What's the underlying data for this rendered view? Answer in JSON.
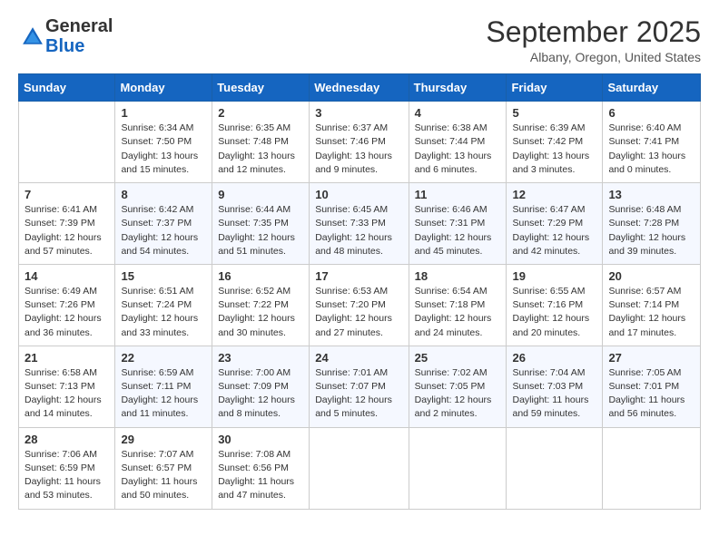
{
  "header": {
    "logo_general": "General",
    "logo_blue": "Blue",
    "month_title": "September 2025",
    "subtitle": "Albany, Oregon, United States"
  },
  "weekdays": [
    "Sunday",
    "Monday",
    "Tuesday",
    "Wednesday",
    "Thursday",
    "Friday",
    "Saturday"
  ],
  "weeks": [
    [
      {
        "day": "",
        "sunrise": "",
        "sunset": "",
        "daylight": ""
      },
      {
        "day": "1",
        "sunrise": "Sunrise: 6:34 AM",
        "sunset": "Sunset: 7:50 PM",
        "daylight": "Daylight: 13 hours and 15 minutes."
      },
      {
        "day": "2",
        "sunrise": "Sunrise: 6:35 AM",
        "sunset": "Sunset: 7:48 PM",
        "daylight": "Daylight: 13 hours and 12 minutes."
      },
      {
        "day": "3",
        "sunrise": "Sunrise: 6:37 AM",
        "sunset": "Sunset: 7:46 PM",
        "daylight": "Daylight: 13 hours and 9 minutes."
      },
      {
        "day": "4",
        "sunrise": "Sunrise: 6:38 AM",
        "sunset": "Sunset: 7:44 PM",
        "daylight": "Daylight: 13 hours and 6 minutes."
      },
      {
        "day": "5",
        "sunrise": "Sunrise: 6:39 AM",
        "sunset": "Sunset: 7:42 PM",
        "daylight": "Daylight: 13 hours and 3 minutes."
      },
      {
        "day": "6",
        "sunrise": "Sunrise: 6:40 AM",
        "sunset": "Sunset: 7:41 PM",
        "daylight": "Daylight: 13 hours and 0 minutes."
      }
    ],
    [
      {
        "day": "7",
        "sunrise": "Sunrise: 6:41 AM",
        "sunset": "Sunset: 7:39 PM",
        "daylight": "Daylight: 12 hours and 57 minutes."
      },
      {
        "day": "8",
        "sunrise": "Sunrise: 6:42 AM",
        "sunset": "Sunset: 7:37 PM",
        "daylight": "Daylight: 12 hours and 54 minutes."
      },
      {
        "day": "9",
        "sunrise": "Sunrise: 6:44 AM",
        "sunset": "Sunset: 7:35 PM",
        "daylight": "Daylight: 12 hours and 51 minutes."
      },
      {
        "day": "10",
        "sunrise": "Sunrise: 6:45 AM",
        "sunset": "Sunset: 7:33 PM",
        "daylight": "Daylight: 12 hours and 48 minutes."
      },
      {
        "day": "11",
        "sunrise": "Sunrise: 6:46 AM",
        "sunset": "Sunset: 7:31 PM",
        "daylight": "Daylight: 12 hours and 45 minutes."
      },
      {
        "day": "12",
        "sunrise": "Sunrise: 6:47 AM",
        "sunset": "Sunset: 7:29 PM",
        "daylight": "Daylight: 12 hours and 42 minutes."
      },
      {
        "day": "13",
        "sunrise": "Sunrise: 6:48 AM",
        "sunset": "Sunset: 7:28 PM",
        "daylight": "Daylight: 12 hours and 39 minutes."
      }
    ],
    [
      {
        "day": "14",
        "sunrise": "Sunrise: 6:49 AM",
        "sunset": "Sunset: 7:26 PM",
        "daylight": "Daylight: 12 hours and 36 minutes."
      },
      {
        "day": "15",
        "sunrise": "Sunrise: 6:51 AM",
        "sunset": "Sunset: 7:24 PM",
        "daylight": "Daylight: 12 hours and 33 minutes."
      },
      {
        "day": "16",
        "sunrise": "Sunrise: 6:52 AM",
        "sunset": "Sunset: 7:22 PM",
        "daylight": "Daylight: 12 hours and 30 minutes."
      },
      {
        "day": "17",
        "sunrise": "Sunrise: 6:53 AM",
        "sunset": "Sunset: 7:20 PM",
        "daylight": "Daylight: 12 hours and 27 minutes."
      },
      {
        "day": "18",
        "sunrise": "Sunrise: 6:54 AM",
        "sunset": "Sunset: 7:18 PM",
        "daylight": "Daylight: 12 hours and 24 minutes."
      },
      {
        "day": "19",
        "sunrise": "Sunrise: 6:55 AM",
        "sunset": "Sunset: 7:16 PM",
        "daylight": "Daylight: 12 hours and 20 minutes."
      },
      {
        "day": "20",
        "sunrise": "Sunrise: 6:57 AM",
        "sunset": "Sunset: 7:14 PM",
        "daylight": "Daylight: 12 hours and 17 minutes."
      }
    ],
    [
      {
        "day": "21",
        "sunrise": "Sunrise: 6:58 AM",
        "sunset": "Sunset: 7:13 PM",
        "daylight": "Daylight: 12 hours and 14 minutes."
      },
      {
        "day": "22",
        "sunrise": "Sunrise: 6:59 AM",
        "sunset": "Sunset: 7:11 PM",
        "daylight": "Daylight: 12 hours and 11 minutes."
      },
      {
        "day": "23",
        "sunrise": "Sunrise: 7:00 AM",
        "sunset": "Sunset: 7:09 PM",
        "daylight": "Daylight: 12 hours and 8 minutes."
      },
      {
        "day": "24",
        "sunrise": "Sunrise: 7:01 AM",
        "sunset": "Sunset: 7:07 PM",
        "daylight": "Daylight: 12 hours and 5 minutes."
      },
      {
        "day": "25",
        "sunrise": "Sunrise: 7:02 AM",
        "sunset": "Sunset: 7:05 PM",
        "daylight": "Daylight: 12 hours and 2 minutes."
      },
      {
        "day": "26",
        "sunrise": "Sunrise: 7:04 AM",
        "sunset": "Sunset: 7:03 PM",
        "daylight": "Daylight: 11 hours and 59 minutes."
      },
      {
        "day": "27",
        "sunrise": "Sunrise: 7:05 AM",
        "sunset": "Sunset: 7:01 PM",
        "daylight": "Daylight: 11 hours and 56 minutes."
      }
    ],
    [
      {
        "day": "28",
        "sunrise": "Sunrise: 7:06 AM",
        "sunset": "Sunset: 6:59 PM",
        "daylight": "Daylight: 11 hours and 53 minutes."
      },
      {
        "day": "29",
        "sunrise": "Sunrise: 7:07 AM",
        "sunset": "Sunset: 6:57 PM",
        "daylight": "Daylight: 11 hours and 50 minutes."
      },
      {
        "day": "30",
        "sunrise": "Sunrise: 7:08 AM",
        "sunset": "Sunset: 6:56 PM",
        "daylight": "Daylight: 11 hours and 47 minutes."
      },
      {
        "day": "",
        "sunrise": "",
        "sunset": "",
        "daylight": ""
      },
      {
        "day": "",
        "sunrise": "",
        "sunset": "",
        "daylight": ""
      },
      {
        "day": "",
        "sunrise": "",
        "sunset": "",
        "daylight": ""
      },
      {
        "day": "",
        "sunrise": "",
        "sunset": "",
        "daylight": ""
      }
    ]
  ]
}
